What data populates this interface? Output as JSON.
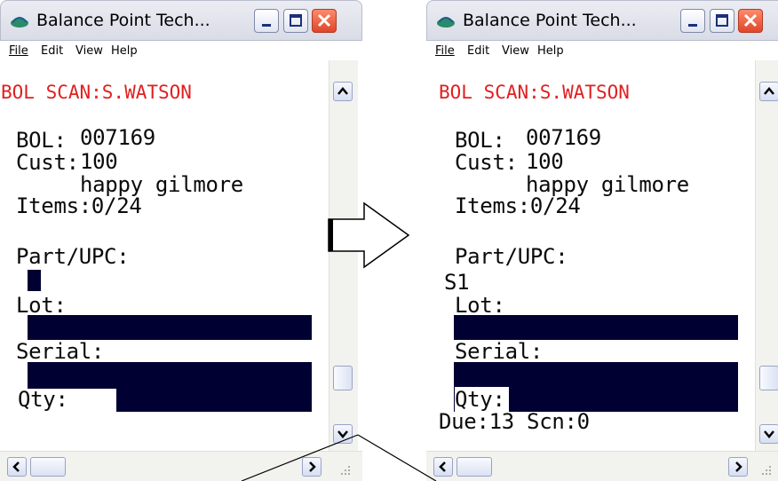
{
  "left_window": {
    "title": "Balance Point Tech...",
    "menu": {
      "file": "File",
      "edit": "Edit",
      "view": "View",
      "help": "Help"
    },
    "scan_line": "BOL SCAN:S.WATSON",
    "bol_label": "BOL:",
    "bol_value": "007169",
    "cust_label": "Cust:",
    "cust_value": "100",
    "cust_name": "happy gilmore",
    "items": "Items:0/24",
    "part_label": "Part/UPC:",
    "lot_label": "Lot:",
    "serial_label": "Serial:",
    "qty_label": "Qty:"
  },
  "right_window": {
    "title": "Balance Point Tech...",
    "menu": {
      "file": "File",
      "edit": "Edit",
      "view": "View",
      "help": "Help"
    },
    "scan_line": "BOL SCAN:S.WATSON",
    "bol_label": "BOL:",
    "bol_value": "007169",
    "cust_label": "Cust:",
    "cust_value": "100",
    "cust_name": "happy gilmore",
    "items": "Items:0/24",
    "part_label": "Part/UPC:",
    "part_value": "S1",
    "lot_label": "Lot:",
    "serial_label": "Serial:",
    "qty_label": "Qty:",
    "due_scan": "Due:13 Scn:0"
  },
  "colors": {
    "scan_text": "#e02020",
    "field_fill": "#000033",
    "close_button": "#e0452a"
  }
}
